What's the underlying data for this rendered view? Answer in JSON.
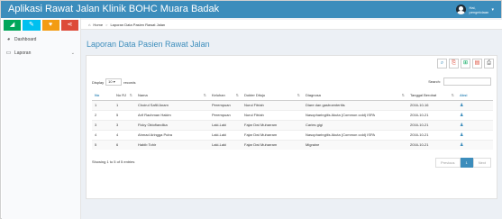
{
  "app": {
    "title": "Aplikasi Rawat Jalan Klinik BOHC Muara Badak"
  },
  "user": {
    "name": "Hai, pengelolaan"
  },
  "quick_buttons": [
    {
      "icon": "chart-icon",
      "glyph": "◢"
    },
    {
      "icon": "pencil-icon",
      "glyph": "✎"
    },
    {
      "icon": "heart-icon",
      "glyph": "♥"
    },
    {
      "icon": "share-icon",
      "glyph": "⋖"
    }
  ],
  "sidebar": {
    "items": [
      {
        "label": "Dashboard",
        "icon": "dashboard-icon",
        "glyph": "◕"
      },
      {
        "label": "Laporan",
        "icon": "laptop-icon",
        "glyph": "▭",
        "caret": "⌄"
      }
    ]
  },
  "breadcrumb": {
    "home": "Home",
    "separator": ">",
    "current": "Laporan Data Pasien Rawat Jalan"
  },
  "page": {
    "title": "Laporan Data Pasien Rawat Jalan"
  },
  "tools": [
    {
      "icon": "search-icon",
      "glyph": "⌕"
    },
    {
      "icon": "copy-icon",
      "glyph": "⎘"
    },
    {
      "icon": "excel-icon",
      "glyph": "⊞"
    },
    {
      "icon": "pdf-icon",
      "glyph": "▤"
    },
    {
      "icon": "print-icon",
      "glyph": "⎙"
    }
  ],
  "table_controls": {
    "display_label": "Display",
    "page_length": "10",
    "records_label": "records",
    "search_label": "Search:"
  },
  "table": {
    "columns": [
      "No",
      "No RJ",
      "Nama",
      "Keluhan",
      "Dokter Dituju",
      "Diagnosa",
      "Tanggal Berobat",
      "Aksi"
    ],
    "rows": [
      [
        "1",
        "1",
        "Choirul Safiil Anam",
        "Perempuan",
        "Nurul Fitriah",
        "Diare dan gastroenteritis",
        "2016-10-16"
      ],
      [
        "2",
        "5",
        "Arif Rachman Hakim",
        "Perempuan",
        "Nurul Fitriah",
        "Nasopharingitis Akuta (Common cold) ISPA",
        "2016-10-21"
      ],
      [
        "3",
        "3",
        "Ficky Oktofiandika",
        "Laki-Laki",
        "Fajar Dwi Muharram",
        "Caries gigi",
        "2016-10-21"
      ],
      [
        "4",
        "4",
        "Ahmad Aringga Putra",
        "Laki-Laki",
        "Fajar Dwi Muharram",
        "Nasopharingitis Akuta (Common cold) ISPA",
        "2016-10-21"
      ],
      [
        "5",
        "6",
        "Habib Tohir",
        "Laki-Laki",
        "Fajar Dwi Muharram",
        "Migraine",
        "2016-10-21"
      ]
    ],
    "action_icon": "user-icon",
    "action_glyph": "♟"
  },
  "footer": {
    "info": "Showing 1 to 5 of 5 entries",
    "previous": "Previous",
    "page": "1",
    "next": "Next"
  }
}
